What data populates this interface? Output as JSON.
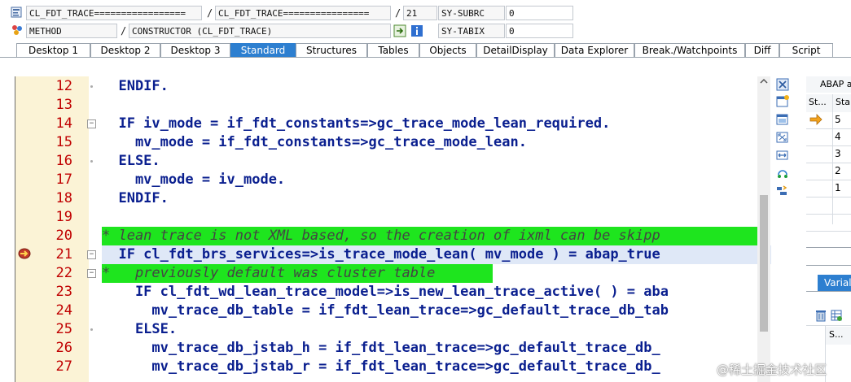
{
  "debugger": {
    "row1": {
      "program": "CL_FDT_TRACE=================",
      "include": "CL_FDT_TRACE================",
      "line": "21",
      "var_name": "SY-SUBRC",
      "var_value": "0"
    },
    "row2": {
      "event_type": "METHOD",
      "event": "CONSTRUCTOR (CL_FDT_TRACE)",
      "var_name": "SY-TABIX",
      "var_value": "0"
    },
    "tabs": [
      "Desktop 1",
      "Desktop 2",
      "Desktop 3",
      "Standard",
      "Structures",
      "Tables",
      "Objects",
      "DetailDisplay",
      "Data Explorer",
      "Break./Watchpoints",
      "Diff",
      "Script"
    ],
    "active_tab": "Standard"
  },
  "code_lines": [
    {
      "num": "12",
      "text": "  ENDIF."
    },
    {
      "num": "13",
      "text": ""
    },
    {
      "num": "14",
      "text": "  IF iv_mode = if_fdt_constants=>gc_trace_mode_lean_required."
    },
    {
      "num": "15",
      "text": "    mv_mode = if_fdt_constants=>gc_trace_mode_lean."
    },
    {
      "num": "16",
      "text": "  ELSE."
    },
    {
      "num": "17",
      "text": "    mv_mode = iv_mode."
    },
    {
      "num": "18",
      "text": "  ENDIF."
    },
    {
      "num": "19",
      "text": ""
    },
    {
      "num": "20",
      "text": "* lean trace is not XML based, so the creation of ixml can be skipp"
    },
    {
      "num": "21",
      "text": "  IF cl_fdt_brs_services=>is_trace_mode_lean( mv_mode ) = abap_true"
    },
    {
      "num": "22",
      "text": "*   previously default was cluster table"
    },
    {
      "num": "23",
      "text": "    IF cl_fdt_wd_lean_trace_model=>is_new_lean_trace_active( ) = aba"
    },
    {
      "num": "24",
      "text": "      mv_trace_db_table = if_fdt_lean_trace=>gc_default_trace_db_tab"
    },
    {
      "num": "25",
      "text": "    ELSE."
    },
    {
      "num": "26",
      "text": "      mv_trace_db_jstab_h = if_fdt_lean_trace=>gc_default_trace_db_"
    },
    {
      "num": "27",
      "text": "      mv_trace_db_jstab_r = if_fdt_lean_trace=>gc_default_trace_db_"
    }
  ],
  "right_panel": {
    "title": "ABAP a",
    "col1": "St...",
    "col2": "Sta",
    "stack_levels": [
      "5",
      "4",
      "3",
      "2",
      "1"
    ],
    "variables_tab": "Varial",
    "var_col": "S..."
  },
  "watermark": "@稀土掘金技术社区",
  "colors": {
    "active_tab": "#2d7fd0",
    "line_number": "#c00000",
    "keyword": "#0000cc",
    "comment_highlight": "#1ee51e",
    "current_line": "#dfe8f7",
    "gutter": "#fbf3d6"
  },
  "icons": [
    "program-icon",
    "method-icon",
    "navigate-icon",
    "info-icon",
    "breakpoint-icon",
    "current-line-arrow-icon"
  ]
}
